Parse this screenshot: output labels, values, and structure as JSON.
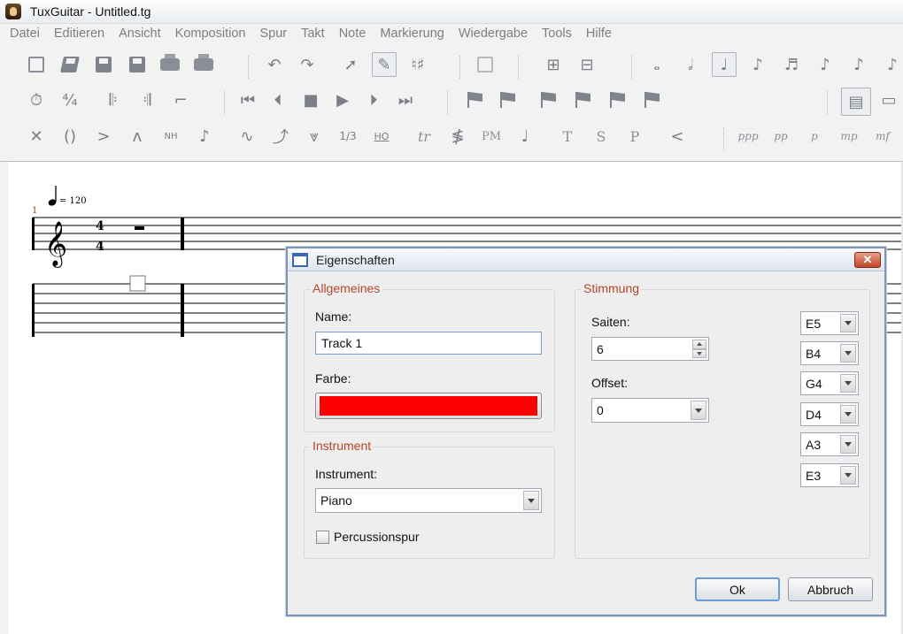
{
  "window": {
    "title": "TuxGuitar - Untitled.tg"
  },
  "menu": [
    "Datei",
    "Editieren",
    "Ansicht",
    "Komposition",
    "Spur",
    "Takt",
    "Note",
    "Markierung",
    "Wiedergabe",
    "Tools",
    "Hilfe"
  ],
  "toolbar": {
    "fraction_label": "1/3",
    "hammer_label": "HO",
    "trill_label": "tr",
    "palm_mute_label": "PM",
    "tap_label": "T",
    "slap_label": "S",
    "pop_label": "P",
    "harmonic_label": "NH",
    "dynamics": [
      "ppp",
      "pp",
      "p",
      "mp",
      "mf"
    ]
  },
  "score": {
    "tempo": "= 120",
    "measure_number": "1",
    "time_signature": {
      "top": "4",
      "bottom": "4"
    }
  },
  "dialog": {
    "title": "Eigenschaften",
    "close_symbol": "✕",
    "general": {
      "heading": "Allgemeines",
      "name_label": "Name:",
      "name_value": "Track 1",
      "color_label": "Farbe:",
      "color_value": "#ff0000"
    },
    "instrument": {
      "heading": "Instrument",
      "instrument_label": "Instrument:",
      "instrument_value": "Piano",
      "percussion_label": "Percussionspur",
      "percussion_checked": false
    },
    "tuning": {
      "heading": "Stimmung",
      "strings_label": "Saiten:",
      "strings_value": "6",
      "offset_label": "Offset:",
      "offset_value": "0",
      "strings": [
        "E5",
        "B4",
        "G4",
        "D4",
        "A3",
        "E3"
      ]
    },
    "ok_label": "Ok",
    "cancel_label": "Abbruch"
  }
}
